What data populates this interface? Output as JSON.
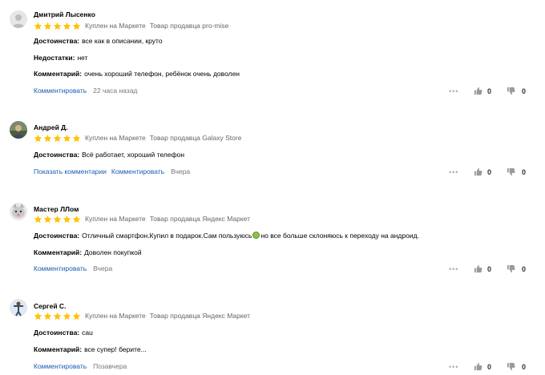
{
  "reviews": [
    {
      "author": "Дмитрий Лысенко",
      "rating": 5,
      "bought": "Куплен на Маркете",
      "seller": "Товар продавца pro-mise",
      "fields": [
        {
          "label": "Достоинства:",
          "text": "все как в описании, круто"
        },
        {
          "label": "Недостатки:",
          "text": "нет"
        },
        {
          "label": "Комментарий:",
          "text": "очень хороший телефон, ребёнок очень доволен"
        }
      ],
      "links": [
        "Комментировать"
      ],
      "time": "22 часа назад",
      "likes": "0",
      "dislikes": "0",
      "avatar_icon": "default-user-icon"
    },
    {
      "author": "Андрей Д.",
      "rating": 5,
      "bought": "Куплен на Маркете",
      "seller": "Товар продавца Galaxy Store",
      "fields": [
        {
          "label": "Достоинства:",
          "text": "Всё работает, хороший телефон"
        }
      ],
      "links": [
        "Показать комментарии",
        "Комментировать"
      ],
      "time": "Вчера",
      "likes": "0",
      "dislikes": "0",
      "avatar_icon": "photo-avatar-icon"
    },
    {
      "author": "Мастер ЛЛом",
      "rating": 5,
      "bought": "Куплен на Маркете",
      "seller": "Товар продавца Яндекс Маркет",
      "fields": [
        {
          "label": "Достоинства:",
          "text_before": "Отличный смартфон.Купил в подарок.Сам пользуюсь",
          "emoji": "green-apple-emoji",
          "text_after": "но все больше склоняюсь к переходу на андроид."
        },
        {
          "label": "Комментарий:",
          "text": "Доволен покупкой"
        }
      ],
      "links": [
        "Комментировать"
      ],
      "time": "Вчера",
      "likes": "0",
      "dislikes": "0",
      "avatar_icon": "cat-avatar-icon"
    },
    {
      "author": "Сергей С.",
      "rating": 5,
      "bought": "Куплен на Маркете",
      "seller": "Товар продавца Яндекс Маркет",
      "fields": [
        {
          "label": "Достоинства:",
          "text": "сau"
        },
        {
          "label": "Комментарий:",
          "text": "все супер! берите..."
        }
      ],
      "links": [
        "Комментировать"
      ],
      "time": "Позавчера",
      "likes": "0",
      "dislikes": "0",
      "avatar_icon": "person-avatar-icon"
    }
  ],
  "colors": {
    "star": "#ffc107",
    "link": "#1a5bb5",
    "meta": "#666666"
  },
  "icons": {
    "more": "more-dots-icon",
    "like": "thumbs-up-icon",
    "dislike": "thumbs-down-icon",
    "star": "star-icon"
  }
}
